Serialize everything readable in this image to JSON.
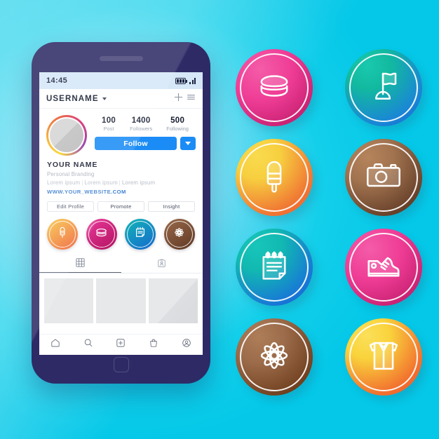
{
  "theme": {
    "background_cyan": "#0fcfe9",
    "phone_body": "#2e2a66",
    "statusbar_bg": "#d6e7f7",
    "follow_blue": "#1b8cf5",
    "link_blue": "#3d7fd0"
  },
  "phone": {
    "statusbar": {
      "clock": "14:45",
      "battery_icon": "battery-icon",
      "signal_icon": "signal-bars-icon"
    },
    "app_header": {
      "username": "USERNAME",
      "dropdown_icon": "chevron-down-icon",
      "add_icon": "plus-icon",
      "menu_icon": "hamburger-menu-icon"
    },
    "profile": {
      "avatar_name": "avatar",
      "stats": [
        {
          "value": "100",
          "label": "Post"
        },
        {
          "value": "1400",
          "label": "Followers"
        },
        {
          "value": "500",
          "label": "Following"
        }
      ],
      "follow_label": "Follow",
      "follow_more_icon": "chevron-down-icon"
    },
    "bio": {
      "name": "YOUR NAME",
      "subtitle": "Personal Branding",
      "lorem_1": "Lorem ipsum",
      "lorem_2": "Lorem ipsum",
      "lorem_3": "Lorem ipsum",
      "separator": "|",
      "website": "WWW.YOUR_WEBSITE.COM"
    },
    "actions": [
      {
        "label": "Edit Profile"
      },
      {
        "label": "Promote"
      },
      {
        "label": "Insight"
      }
    ],
    "highlights": [
      {
        "icon": "popsicle-icon",
        "color_start": "#f7c948",
        "color_end": "#ef5b32"
      },
      {
        "icon": "macaron-icon",
        "color_start": "#e8399a",
        "color_end": "#b2125f"
      },
      {
        "icon": "notepad-icon",
        "color_start": "#12b5b5",
        "color_end": "#1668cf"
      },
      {
        "icon": "flower-icon",
        "color_start": "#9a6a4a",
        "color_end": "#5e3724"
      }
    ],
    "tabs": [
      {
        "icon": "grid-icon",
        "active": true
      },
      {
        "icon": "tagged-person-icon",
        "active": false
      }
    ],
    "grid_cells": 3,
    "bottom_nav": [
      {
        "icon": "home-icon"
      },
      {
        "icon": "search-icon"
      },
      {
        "icon": "add-square-icon"
      },
      {
        "icon": "shopping-bag-icon"
      },
      {
        "icon": "profile-circle-icon"
      }
    ],
    "home_button_icon": "home-button-icon",
    "speaker_icon": "speaker-slot"
  },
  "badges": [
    {
      "icon": "macaron-icon",
      "color_start": "#ef3d96",
      "color_end": "#b5135f"
    },
    {
      "icon": "flag-icon",
      "color_start": "#12b99f",
      "color_end": "#1560d0"
    },
    {
      "icon": "popsicle-icon",
      "color_start": "#f7cf3f",
      "color_end": "#ef5430"
    },
    {
      "icon": "camera-icon",
      "color_start": "#a1734f",
      "color_end": "#4f2d1c"
    },
    {
      "icon": "notepad-icon",
      "color_start": "#11b9b1",
      "color_end": "#1461cf"
    },
    {
      "icon": "sneaker-icon",
      "color_start": "#ef3d96",
      "color_end": "#b5135f"
    },
    {
      "icon": "flower-icon",
      "color_start": "#9c6c4b",
      "color_end": "#5b3322"
    },
    {
      "icon": "shirt-icon",
      "color_start": "#f9d33c",
      "color_end": "#ee4d2f"
    }
  ]
}
